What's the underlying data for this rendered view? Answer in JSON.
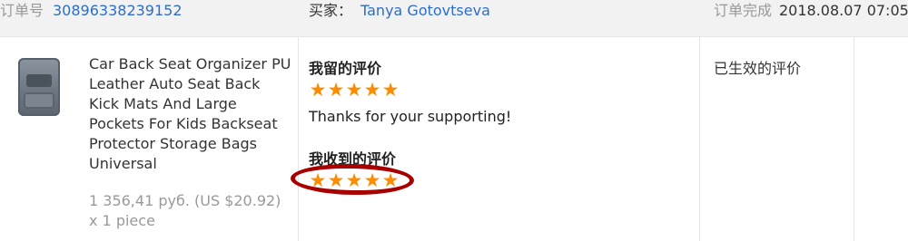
{
  "order": {
    "number_label": "订单号",
    "number_value": "30896338239152",
    "buyer_label": "买家：",
    "buyer_name": "Tanya Gotovtseva",
    "complete_label": "订单完成",
    "complete_time": "2018.08.07 07:05"
  },
  "product": {
    "image_icon": "seat-organizer-thumbnail",
    "title": "Car Back Seat Organizer PU Leather Auto Seat Back Kick Mats And Large Pockets For Kids Backseat Protector Storage Bags Universal",
    "price": "1 356,41 руб. (US $20.92)",
    "quantity": "x 1 piece"
  },
  "feedback": {
    "my_feedback_label": "我留的评价",
    "my_stars": 5,
    "my_comment": "Thanks for your supporting!",
    "received_label": "我收到的评价",
    "received_stars": 5,
    "star_color": "#ff8c00",
    "highlight_color": "#a80000"
  },
  "status": {
    "text": "已生效的评价"
  }
}
